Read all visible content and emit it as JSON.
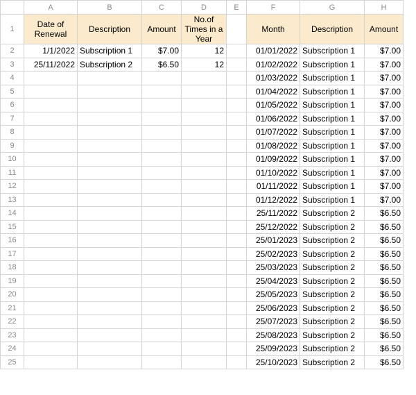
{
  "columns": [
    "A",
    "B",
    "C",
    "D",
    "E",
    "F",
    "G",
    "H"
  ],
  "left_headers": {
    "A": "Date of Renewal",
    "B": "Description",
    "C": "Amount",
    "D": "No.of Times in a Year"
  },
  "right_headers": {
    "F": "Month",
    "G": "Description",
    "H": "Amount"
  },
  "left_rows": [
    {
      "A": "1/1/2022",
      "B": "Subscription 1",
      "C": "$7.00",
      "D": "12"
    },
    {
      "A": "25/11/2022",
      "B": "Subscription 2",
      "C": "$6.50",
      "D": "12"
    }
  ],
  "right_rows": [
    {
      "F": "01/01/2022",
      "G": "Subscription 1",
      "H": "$7.00"
    },
    {
      "F": "01/02/2022",
      "G": "Subscription 1",
      "H": "$7.00"
    },
    {
      "F": "01/03/2022",
      "G": "Subscription 1",
      "H": "$7.00"
    },
    {
      "F": "01/04/2022",
      "G": "Subscription 1",
      "H": "$7.00"
    },
    {
      "F": "01/05/2022",
      "G": "Subscription 1",
      "H": "$7.00"
    },
    {
      "F": "01/06/2022",
      "G": "Subscription 1",
      "H": "$7.00"
    },
    {
      "F": "01/07/2022",
      "G": "Subscription 1",
      "H": "$7.00"
    },
    {
      "F": "01/08/2022",
      "G": "Subscription 1",
      "H": "$7.00"
    },
    {
      "F": "01/09/2022",
      "G": "Subscription 1",
      "H": "$7.00"
    },
    {
      "F": "01/10/2022",
      "G": "Subscription 1",
      "H": "$7.00"
    },
    {
      "F": "01/11/2022",
      "G": "Subscription 1",
      "H": "$7.00"
    },
    {
      "F": "01/12/2022",
      "G": "Subscription 1",
      "H": "$7.00"
    },
    {
      "F": "25/11/2022",
      "G": "Subscription 2",
      "H": "$6.50"
    },
    {
      "F": "25/12/2022",
      "G": "Subscription 2",
      "H": "$6.50"
    },
    {
      "F": "25/01/2023",
      "G": "Subscription 2",
      "H": "$6.50"
    },
    {
      "F": "25/02/2023",
      "G": "Subscription 2",
      "H": "$6.50"
    },
    {
      "F": "25/03/2023",
      "G": "Subscription 2",
      "H": "$6.50"
    },
    {
      "F": "25/04/2023",
      "G": "Subscription 2",
      "H": "$6.50"
    },
    {
      "F": "25/05/2023",
      "G": "Subscription 2",
      "H": "$6.50"
    },
    {
      "F": "25/06/2023",
      "G": "Subscription 2",
      "H": "$6.50"
    },
    {
      "F": "25/07/2023",
      "G": "Subscription 2",
      "H": "$6.50"
    },
    {
      "F": "25/08/2023",
      "G": "Subscription 2",
      "H": "$6.50"
    },
    {
      "F": "25/09/2023",
      "G": "Subscription 2",
      "H": "$6.50"
    },
    {
      "F": "25/10/2023",
      "G": "Subscription 2",
      "H": "$6.50"
    }
  ],
  "total_rows": 25
}
